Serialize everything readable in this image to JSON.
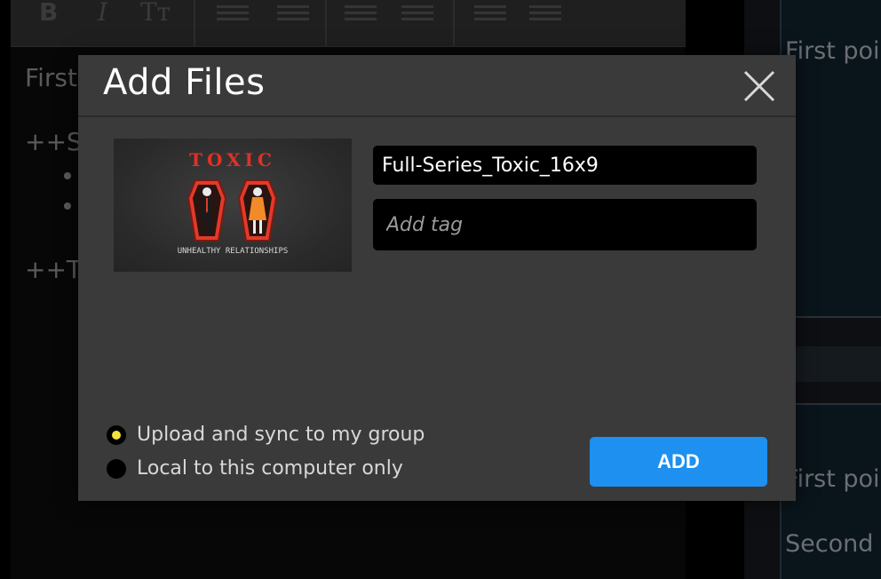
{
  "background": {
    "toolbar_icons": [
      "bold-icon",
      "italic-icon",
      "text-size-icon",
      "bulleted-list-icon",
      "numbered-list-icon",
      "outdent-icon",
      "indent-icon",
      "insert-icon",
      "split-icon"
    ],
    "editor_lines": [
      "First",
      "++Se",
      "++Th"
    ],
    "right_lines": [
      "First poi",
      "First poi",
      "Second"
    ]
  },
  "modal": {
    "title": "Add Files",
    "close_icon": "close-icon",
    "thumbnail": {
      "title": "TOXIC",
      "subtitle": "UNHEALTHY RELATIONSHIPS"
    },
    "name_value": "Full-Series_Toxic_16x9",
    "tag_placeholder": "Add tag",
    "options": [
      {
        "label": "Upload and sync to my group",
        "checked": true
      },
      {
        "label": "Local to this computer only",
        "checked": false
      }
    ],
    "add_button": "ADD",
    "colors": {
      "accent": "#1e90f0",
      "radio_selected": "#f2e33a",
      "thumb_red": "#e03028"
    }
  }
}
